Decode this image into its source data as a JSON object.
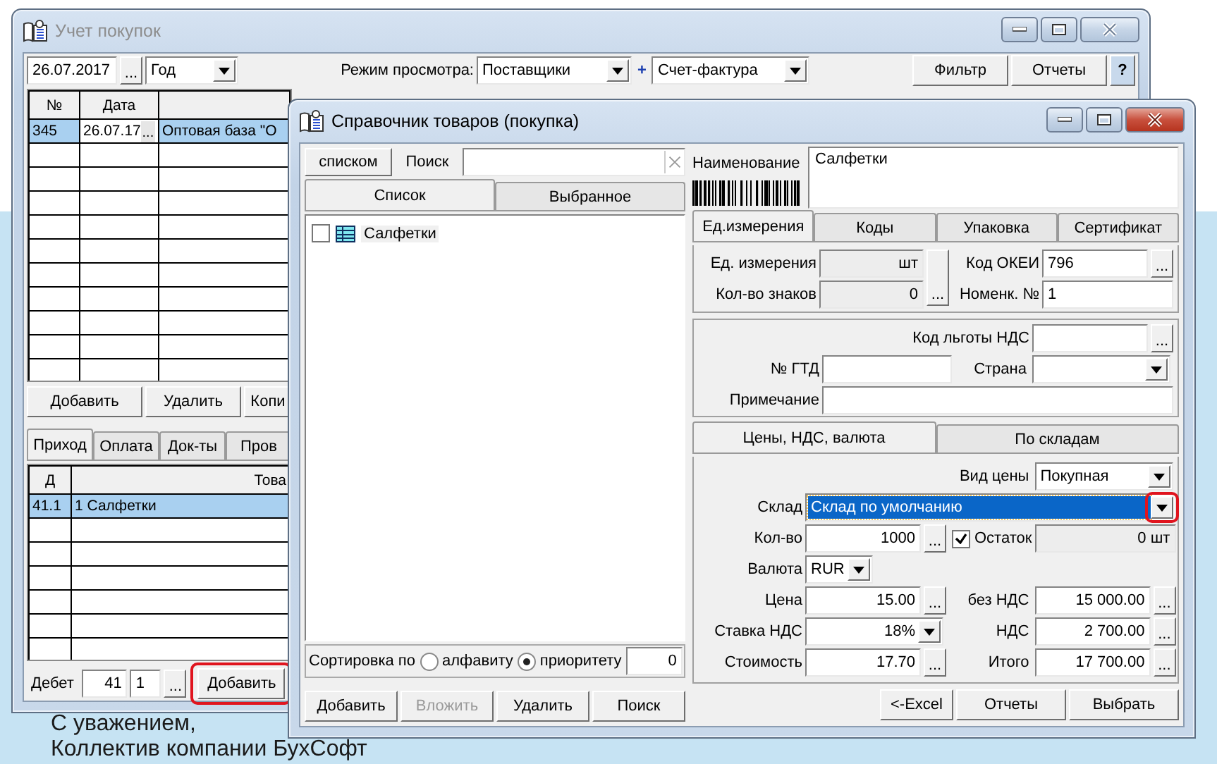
{
  "desktop": {
    "lines": [
      "С уважением,",
      "Коллектив компании БухСофт"
    ]
  },
  "purchases_window": {
    "title": "Учет покупок",
    "active": false,
    "toolbar": {
      "date": "26.07.2017",
      "date_button": "...",
      "period": "Год",
      "view_label": "Режим просмотра:",
      "view": "Поставщики",
      "plus": "+",
      "doc_type": "Счет-фактура",
      "buttons": [
        "Фильтр",
        "Отчеты"
      ],
      "help": "?"
    },
    "table": {
      "columns": [
        "№",
        "Дата"
      ],
      "rows": [
        {
          "number": "345",
          "date": "26.07.17",
          "date_button": "...",
          "supplier": "Оптовая база \"О",
          "selected": true
        }
      ]
    },
    "buttons": [
      "Добавить",
      "Удалить",
      "Копи"
    ],
    "tabs": [
      {
        "label": "Приход",
        "selected": true
      },
      {
        "label": "Оплата",
        "selected": false
      },
      {
        "label": "Док-ты",
        "selected": false
      },
      {
        "label": "Пров",
        "selected": false
      }
    ],
    "lines_table": {
      "columns": [
        "Д",
        "Това"
      ],
      "rows": [
        {
          "account": "41.1",
          "goods": "1 Салфетки",
          "selected": true
        }
      ]
    },
    "debit": {
      "label": "Дебет",
      "account": "41",
      "sub": "1",
      "button": "...",
      "add_button": {
        "label": "Добавить",
        "highlighted": true
      }
    }
  },
  "goods_window": {
    "title": "Справочник товаров (покупка)",
    "active": true,
    "search": {
      "mode_button": "списком",
      "label": "Поиск"
    },
    "list_tabs": [
      {
        "label": "Список",
        "selected": true
      },
      {
        "label": "Выбранное",
        "selected": false
      }
    ],
    "items": [
      {
        "label": "Салфетки",
        "checked": false
      }
    ],
    "sort": {
      "label": "Сортировка по",
      "options": [
        {
          "label": "алфавиту",
          "selected": false
        },
        {
          "label": "приоритету",
          "selected": true
        }
      ],
      "value": "0"
    },
    "left_buttons": [
      {
        "label": "Добавить",
        "disabled": false
      },
      {
        "label": "Вложить",
        "disabled": true
      },
      {
        "label": "Удалить",
        "disabled": false
      },
      {
        "label": "Поиск",
        "disabled": false
      }
    ],
    "name": {
      "label": "Наименование",
      "value": "Салфетки"
    },
    "detail_tabs": [
      {
        "label": "Ед.измерения",
        "selected": true
      },
      {
        "label": "Коды",
        "selected": false
      },
      {
        "label": "Упаковка",
        "selected": false
      },
      {
        "label": "Сертификат",
        "selected": false
      }
    ],
    "units": {
      "unit": {
        "label": "Ед. измерения",
        "value": "шт"
      },
      "digits": {
        "label": "Кол-во знаков",
        "value": "0"
      },
      "button": "...",
      "okei": {
        "label": "Код ОКЕИ",
        "value": "796",
        "button": "..."
      },
      "nomenclature": {
        "label": "Номенк. №",
        "value": "1"
      }
    },
    "extra": {
      "vat_benefit": {
        "label": "Код льготы НДС",
        "button": "..."
      },
      "gtd": {
        "label": "№ ГТД"
      },
      "country": {
        "label": "Страна"
      },
      "note": {
        "label": "Примечание"
      }
    },
    "price_tabs": [
      {
        "label": "Цены, НДС, валюта",
        "selected": true
      },
      {
        "label": "По складам",
        "selected": false
      }
    ],
    "prices": {
      "price_type": {
        "label": "Вид цены",
        "value": "Покупная"
      },
      "warehouse": {
        "label": "Склад",
        "value": "Склад по умолчанию",
        "focused": true,
        "highlighted": true
      },
      "quantity": {
        "label": "Кол-во",
        "value": "1000",
        "button": "..."
      },
      "balance": {
        "label": "Остаток",
        "checked": true,
        "value": "0 шт"
      },
      "currency": {
        "label": "Валюта",
        "value": "RUR"
      },
      "rows": [
        {
          "left": {
            "label": "Цена",
            "value": "15.00",
            "kind": "browse",
            "button": "..."
          },
          "right": {
            "label": "без НДС",
            "value": "15 000.00",
            "button": "..."
          }
        },
        {
          "left": {
            "label": "Ставка НДС",
            "value": "18%",
            "kind": "dropdown"
          },
          "right": {
            "label": "НДС",
            "value": "2 700.00",
            "button": "..."
          }
        },
        {
          "left": {
            "label": "Стоимость",
            "value": "17.70",
            "kind": "browse",
            "button": "..."
          },
          "right": {
            "label": "Итого",
            "value": "17 700.00",
            "button": "..."
          }
        }
      ]
    },
    "bottom_buttons": [
      "<-Excel",
      "Отчеты",
      "Выбрать"
    ]
  }
}
